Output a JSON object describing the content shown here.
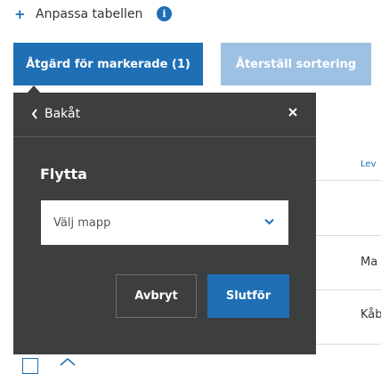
{
  "toolbar": {
    "customize_label": "Anpassa tabellen",
    "plus_glyph": "+",
    "info_glyph": "i",
    "action_button_label": "Åtgärd för markerade (1)",
    "reset_sort_label": "Återställ sortering"
  },
  "table": {
    "column_header_partial": "Lev",
    "rows_partial": [
      "Ma",
      "Kåb"
    ]
  },
  "popup": {
    "back_label": "Bakåt",
    "title": "Flytta",
    "folder_select": {
      "value": "Välj mapp"
    },
    "cancel_label": "Avbryt",
    "finish_label": "Slutför"
  },
  "icons": {
    "info": "info-icon",
    "back": "chevron-left-icon",
    "close": "close-icon",
    "dropdown": "chevron-down-icon"
  },
  "colors": {
    "primary": "#1f6fb5",
    "primary_disabled": "#9dc1e2",
    "popup_bg": "#3d3e3e"
  }
}
